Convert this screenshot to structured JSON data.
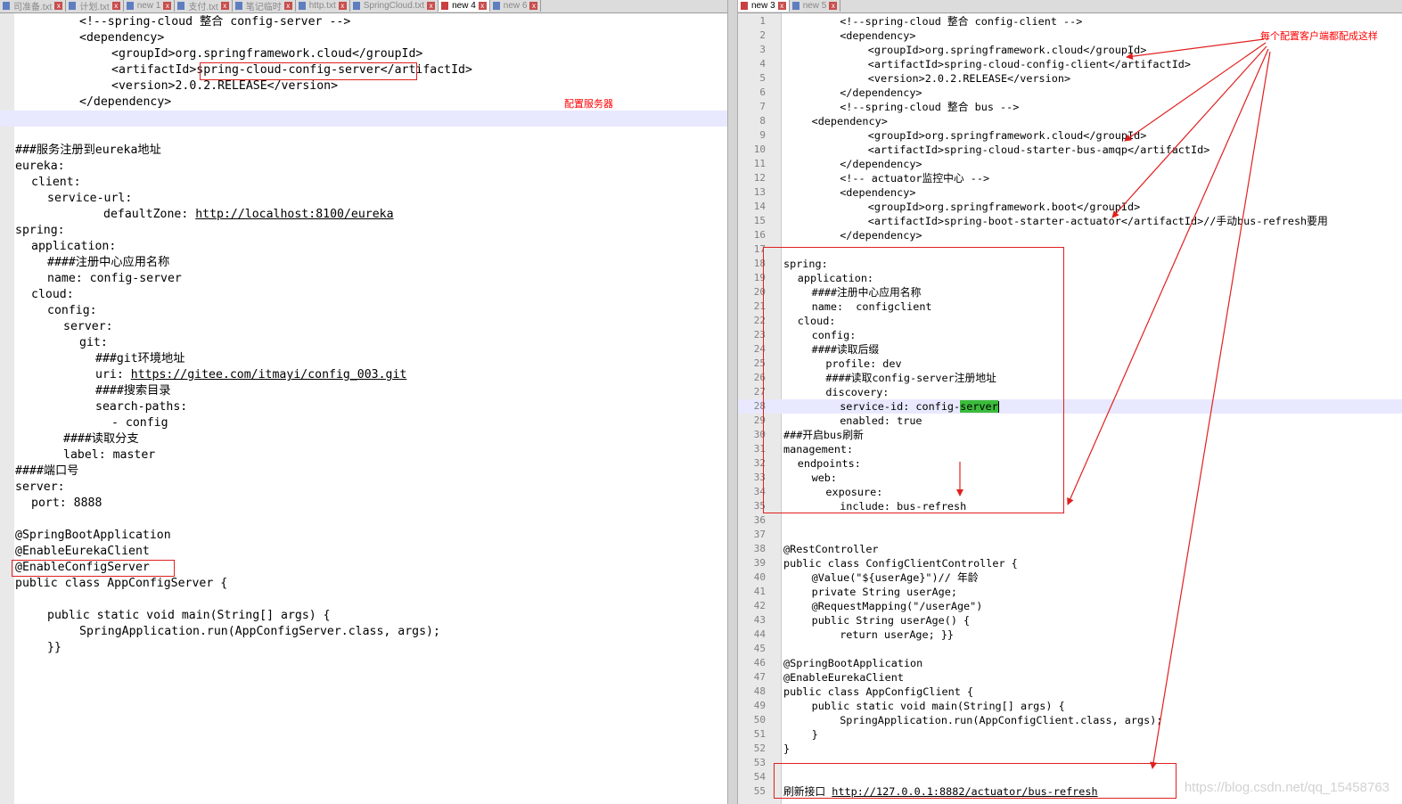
{
  "left_editor": {
    "tabs": [
      {
        "label": "司准备.txt",
        "active": false
      },
      {
        "label": "计划.txt",
        "active": false
      },
      {
        "label": "new 1",
        "active": false
      },
      {
        "label": "支付.txt",
        "active": false
      },
      {
        "label": "笔记临时",
        "active": false
      },
      {
        "label": "http.txt",
        "active": false
      },
      {
        "label": "SpringCloud.txt",
        "active": false
      },
      {
        "label": "new 4",
        "active": true
      },
      {
        "label": "new 6",
        "active": false
      }
    ],
    "lines": [
      "<!--spring-cloud 整合 config-server -->",
      "<dependency>",
      "<groupId>org.springframework.cloud</groupId>",
      "<artifactId>spring-cloud-config-server</artifactId>",
      "<version>2.0.2.RELEASE</version>",
      "</dependency>",
      "",
      "",
      "###服务注册到eureka地址",
      "eureka:",
      "client:",
      "service-url:",
      "defaultZone: ",
      "spring:",
      "application:",
      "####注册中心应用名称",
      "name: config-server",
      "cloud:",
      "config:",
      "server:",
      "git:",
      "###git环境地址",
      "uri: ",
      "####搜索目录",
      "search-paths:",
      "- config",
      "####读取分支",
      "label: master",
      "####端口号",
      "server:",
      "port: 8888",
      "",
      "@SpringBootApplication",
      "@EnableEurekaClient",
      "@EnableConfigServer",
      "public class AppConfigServer {",
      "",
      "public static void main(String[] args) {",
      "SpringApplication.run(AppConfigServer.class, args);",
      "}}"
    ],
    "eureka_url": "http://localhost:8100/eureka",
    "git_url": "https://gitee.com/itmayi/config_003.git",
    "note": "配置服务器"
  },
  "right_editor": {
    "tabs": [
      {
        "label": "new 3",
        "active": true
      },
      {
        "label": "new 5",
        "active": false
      }
    ],
    "lines": [
      "<!--spring-cloud 整合 config-client -->",
      "<dependency>",
      "<groupId>org.springframework.cloud</groupId>",
      "<artifactId>spring-cloud-config-client</artifactId>",
      "<version>2.0.2.RELEASE</version>",
      "</dependency>",
      "<!--spring-cloud 整合 bus -->",
      "<dependency>",
      "<groupId>org.springframework.cloud</groupId>",
      "<artifactId>spring-cloud-starter-bus-amqp</artifactId>",
      "</dependency>",
      "<!-- actuator监控中心 -->",
      "<dependency>",
      "<groupId>org.springframework.boot</groupId>",
      "<artifactId>spring-boot-starter-actuator</artifactId>//手动bus-refresh要用",
      "</dependency>",
      "",
      "spring:",
      "application:",
      "####注册中心应用名称",
      "name:  configclient",
      "cloud:",
      "config:",
      "####读取后缀",
      "profile: dev",
      "####读取config-server注册地址",
      "discovery:",
      "service-id: config-",
      "enabled: true",
      "###开启bus刷新",
      "management:",
      "endpoints:",
      "web:",
      "exposure:",
      "include: bus-refresh",
      "",
      "",
      "@RestController",
      "public class ConfigClientController {",
      "@Value(\"${userAge}\")// 年龄",
      "private String userAge;",
      "@RequestMapping(\"/userAge\")",
      "public String userAge() {",
      "return userAge; }}",
      "",
      "@SpringBootApplication",
      "@EnableEurekaClient",
      "public class AppConfigClient {",
      "public static void main(String[] args) {",
      "SpringApplication.run(AppConfigClient.class, args);",
      "}",
      "}",
      "",
      "",
      "刷新接口 "
    ],
    "service_id_highlight": "server",
    "refresh_url": "http://127.0.0.1:8882/actuator/bus-refresh",
    "note": "每个配置客户端都配成这样"
  },
  "watermark": "https://blog.csdn.net/qq_15458763",
  "colors": {
    "annotation": "#e0201f",
    "current_line": "#e8e8ff",
    "selection": "#3cbc3c"
  }
}
